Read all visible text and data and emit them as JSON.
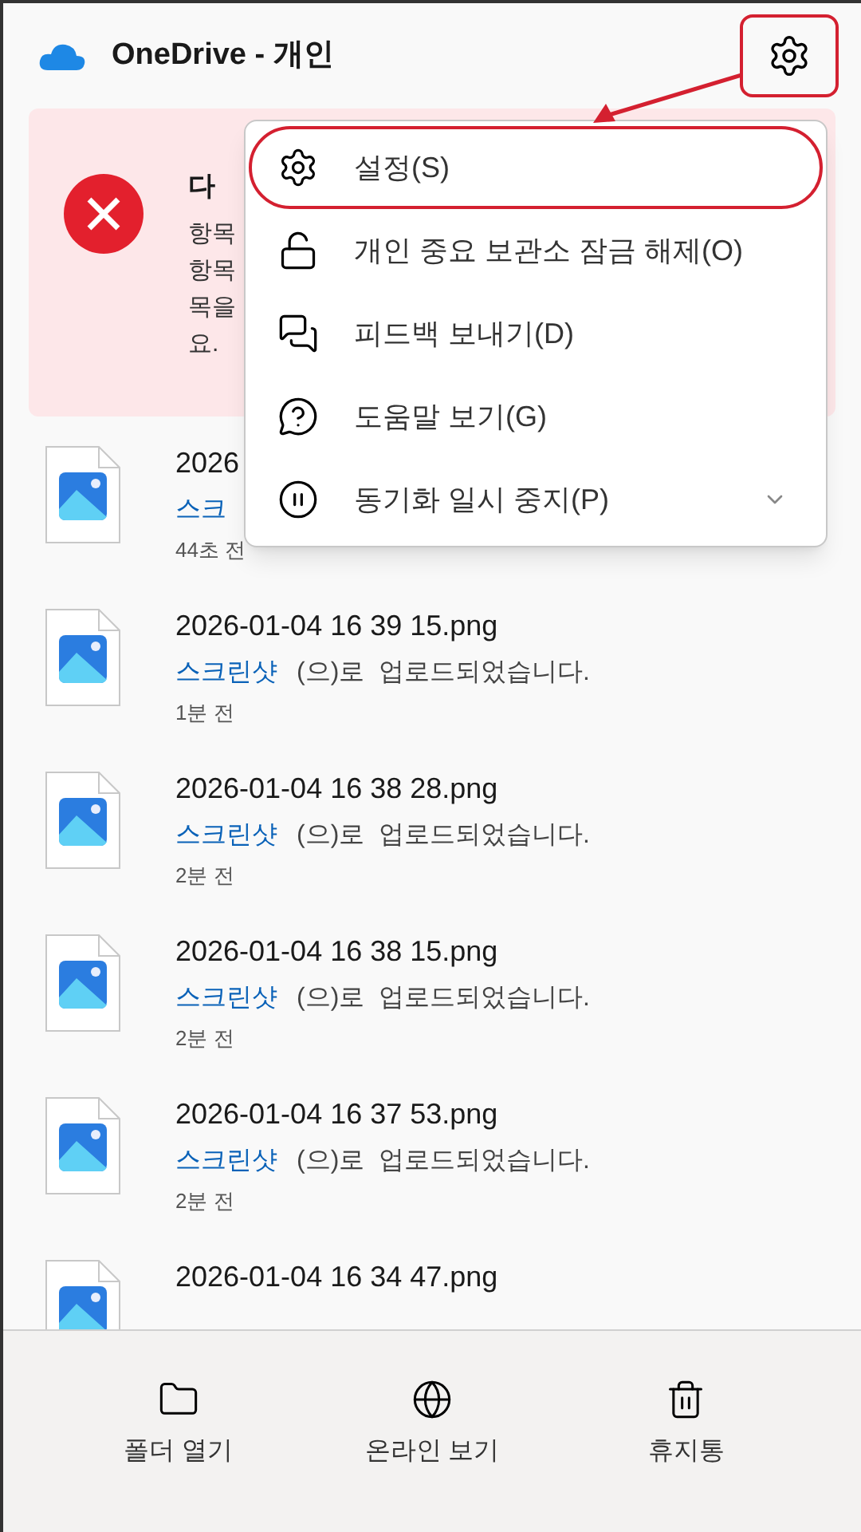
{
  "header": {
    "title": "OneDrive - 개인"
  },
  "error_banner": {
    "title": "다",
    "lines": [
      "항목",
      "항목",
      "목을",
      "요."
    ]
  },
  "menu": {
    "items": [
      {
        "kind": "settings",
        "label": "설정(S)",
        "highlighted": true,
        "chevron": false
      },
      {
        "kind": "unlock",
        "label": "개인 중요 보관소 잠금 해제(O)",
        "highlighted": false,
        "chevron": false
      },
      {
        "kind": "feedback",
        "label": "피드백 보내기(D)",
        "highlighted": false,
        "chevron": false
      },
      {
        "kind": "help",
        "label": "도움말 보기(G)",
        "highlighted": false,
        "chevron": false
      },
      {
        "kind": "pause",
        "label": "동기화 일시 중지(P)",
        "highlighted": false,
        "chevron": true
      }
    ]
  },
  "files": [
    {
      "name": "2026",
      "link": "스크",
      "time": "44초 전"
    },
    {
      "name": "2026-01-04 16 39 15.png",
      "link": "스크린샷",
      "status": "(으)로  업로드되었습니다.",
      "time": "1분 전"
    },
    {
      "name": "2026-01-04 16 38 28.png",
      "link": "스크린샷",
      "status": "(으)로  업로드되었습니다.",
      "time": "2분 전"
    },
    {
      "name": "2026-01-04 16 38 15.png",
      "link": "스크린샷",
      "status": "(으)로  업로드되었습니다.",
      "time": "2분 전"
    },
    {
      "name": "2026-01-04 16 37 53.png",
      "link": "스크린샷",
      "status": "(으)로  업로드되었습니다.",
      "time": "2분 전"
    },
    {
      "name": "2026-01-04 16 34 47.png"
    }
  ],
  "footer": [
    {
      "kind": "folder",
      "label": "폴더 열기"
    },
    {
      "kind": "globe",
      "label": "온라인 보기"
    },
    {
      "kind": "trash",
      "label": "휴지통"
    }
  ]
}
